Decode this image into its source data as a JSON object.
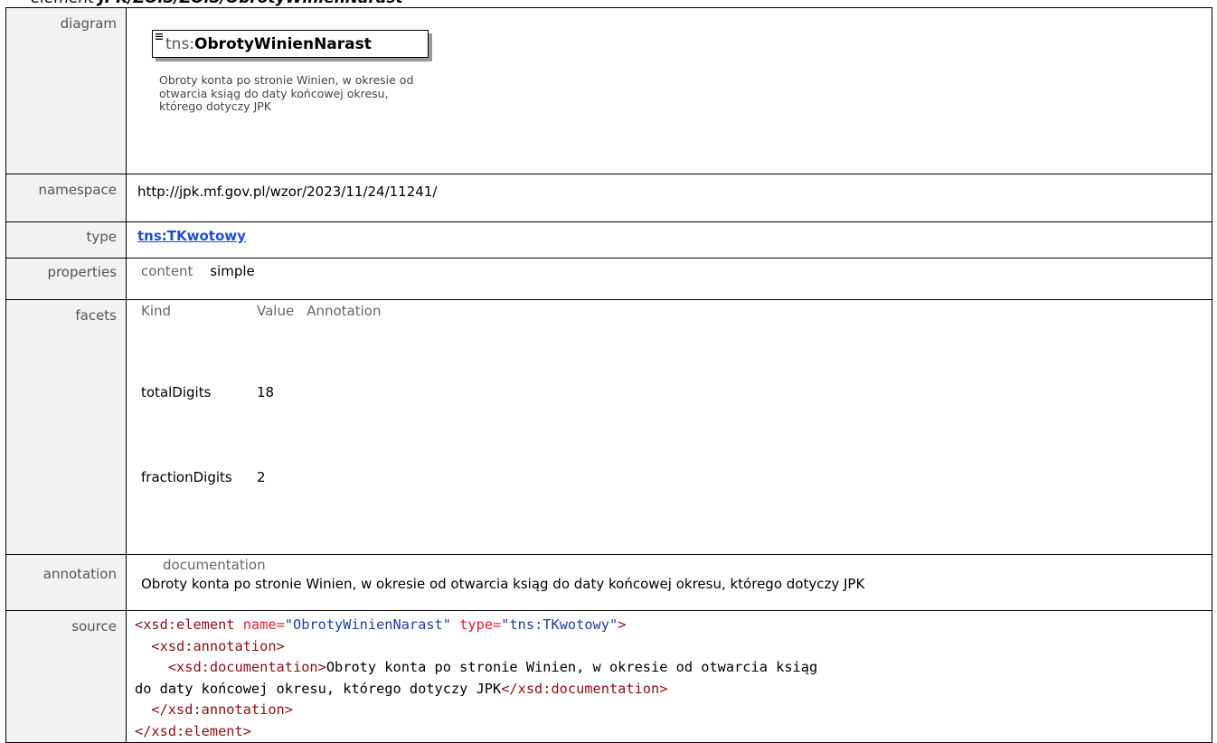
{
  "heading": {
    "prefix": "element ",
    "path": "JPK/ZOiS/ZOiS/ObrotyWinienNarast"
  },
  "labels": {
    "diagram": "diagram",
    "namespace": "namespace",
    "type": "type",
    "properties": "properties",
    "facets": "facets",
    "annotation": "annotation",
    "source": "source"
  },
  "diagram": {
    "prefix": "tns:",
    "name": "ObrotyWinienNarast",
    "description": "Obroty konta po stronie Winien, w okresie od otwarcia ksiąg do daty końcowej okresu, którego dotyczy JPK"
  },
  "namespace": "http://jpk.mf.gov.pl/wzor/2023/11/24/11241/",
  "type_link": "tns:TKwotowy",
  "properties": {
    "key": "content",
    "value": "simple"
  },
  "facets": {
    "headers": [
      "Kind",
      "Value",
      "Annotation"
    ],
    "rows": [
      {
        "kind": "totalDigits",
        "value": "18"
      },
      {
        "kind": "fractionDigits",
        "value": "2"
      }
    ]
  },
  "annotation": {
    "head": "documentation",
    "text": "Obroty konta po stronie Winien, w okresie od otwarcia ksiąg do daty końcowej okresu, którego dotyczy JPK"
  },
  "source": {
    "l1_tag": "<xsd:element",
    "l1_attr1": " name=",
    "l1_val1": "\"ObrotyWinienNarast\"",
    "l1_attr2": " type=",
    "l1_val2": "\"tns:TKwotowy\"",
    "l1_close": ">",
    "l2": "  <xsd:annotation>",
    "l3_open": "    <xsd:documentation>",
    "l3_text": "Obroty konta po stronie Winien, w okresie od otwarcia ksiąg",
    "l4_text": "do daty końcowej okresu, którego dotyczy JPK",
    "l4_close": "</xsd:documentation>",
    "l5": "  </xsd:annotation>",
    "l6": "</xsd:element>"
  }
}
